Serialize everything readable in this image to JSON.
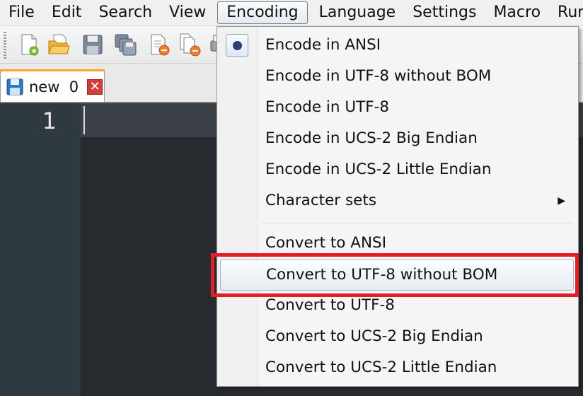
{
  "menubar": {
    "items": [
      {
        "label": "File"
      },
      {
        "label": "Edit"
      },
      {
        "label": "Search"
      },
      {
        "label": "View"
      },
      {
        "label": "Encoding"
      },
      {
        "label": "Language"
      },
      {
        "label": "Settings"
      },
      {
        "label": "Macro"
      },
      {
        "label": "Run"
      }
    ],
    "active": "Encoding"
  },
  "toolbar": {
    "buttons": [
      "new-file-icon",
      "open-folder-icon",
      "save-icon",
      "save-all-icon",
      "close-icon",
      "close-all-icon",
      "print-icon"
    ]
  },
  "tab": {
    "label": "new  0",
    "close_glyph": "✕"
  },
  "editor": {
    "line_number": "1"
  },
  "encoding_menu": {
    "items": [
      {
        "label": "Encode in ANSI"
      },
      {
        "label": "Encode in UTF-8 without BOM"
      },
      {
        "label": "Encode in UTF-8"
      },
      {
        "label": "Encode in UCS-2 Big Endian"
      },
      {
        "label": "Encode in UCS-2 Little Endian"
      },
      {
        "label": "Character sets"
      },
      {
        "label": "Convert to ANSI"
      },
      {
        "label": "Convert to UTF-8 without BOM"
      },
      {
        "label": "Convert to UTF-8"
      },
      {
        "label": "Convert to UCS-2 Big Endian"
      },
      {
        "label": "Convert to UCS-2 Little Endian"
      }
    ],
    "selected": "Encode in ANSI",
    "highlighted": "Convert to UTF-8 without BOM",
    "submenu_arrow": "▶"
  },
  "colors": {
    "highlight_outline": "#e21f26",
    "tab_accent": "#f9a328",
    "editor_bg": "#272b30",
    "gutter_bg": "#2f3a40"
  }
}
